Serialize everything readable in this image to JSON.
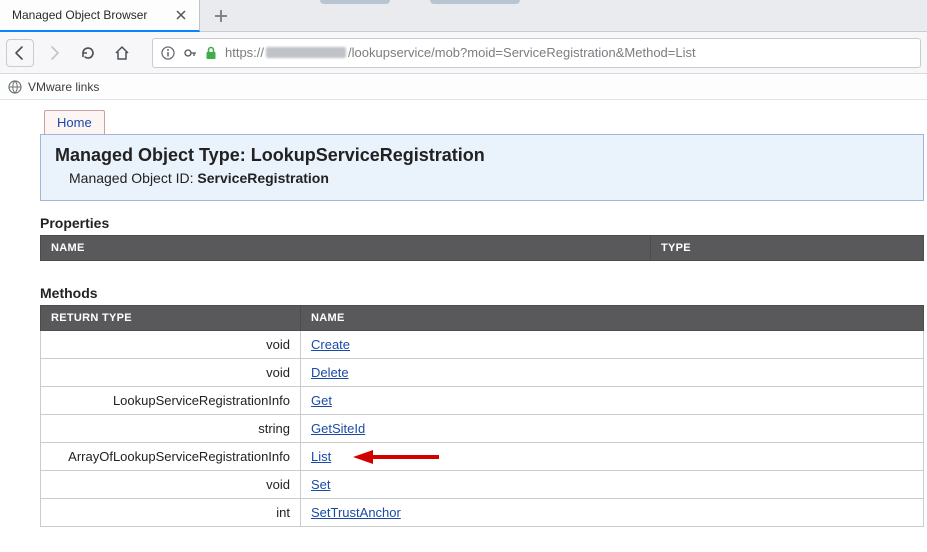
{
  "browser": {
    "tab_title": "Managed Object Browser",
    "bookmarks_bar_item": "VMware links",
    "url_prefix": "https://",
    "url_suffix": "/lookupservice/mob?moid=ServiceRegistration&Method=List"
  },
  "page": {
    "home_label": "Home",
    "object_type_label": "Managed Object Type:",
    "object_type_value": "LookupServiceRegistration",
    "object_id_label": "Managed Object ID:",
    "object_id_value": "ServiceRegistration"
  },
  "properties": {
    "heading": "Properties",
    "columns": {
      "name": "NAME",
      "type": "TYPE"
    },
    "rows": []
  },
  "methods": {
    "heading": "Methods",
    "columns": {
      "return_type": "RETURN TYPE",
      "name": "NAME"
    },
    "rows": [
      {
        "return_type": "void",
        "name": "Create"
      },
      {
        "return_type": "void",
        "name": "Delete"
      },
      {
        "return_type": "LookupServiceRegistrationInfo",
        "name": "Get"
      },
      {
        "return_type": "string",
        "name": "GetSiteId"
      },
      {
        "return_type": "ArrayOfLookupServiceRegistrationInfo",
        "name": "List",
        "highlight": true
      },
      {
        "return_type": "void",
        "name": "Set"
      },
      {
        "return_type": "int",
        "name": "SetTrustAnchor"
      }
    ]
  }
}
